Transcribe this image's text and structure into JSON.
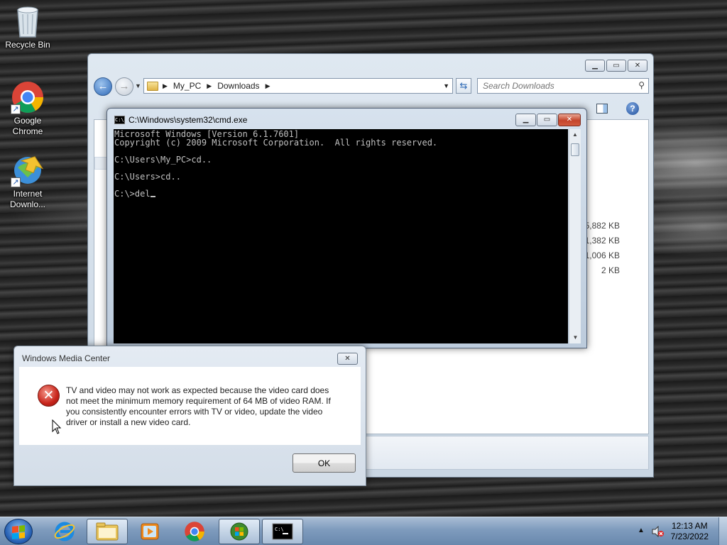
{
  "desktop": {
    "icons": [
      {
        "label": "Recycle Bin"
      },
      {
        "label": "Google Chrome"
      },
      {
        "label": "Internet Downlo..."
      }
    ]
  },
  "explorer": {
    "breadcrumb": [
      "My_PC",
      "Downloads"
    ],
    "search_placeholder": "Search Downloads",
    "file_sizes": [
      "75,882 KB",
      "1,382 KB",
      "11,006 KB",
      "2 KB"
    ]
  },
  "cmd": {
    "title": "C:\\Windows\\system32\\cmd.exe",
    "lines": [
      "Microsoft Windows [Version 6.1.7601]",
      "Copyright (c) 2009 Microsoft Corporation.  All rights reserved.",
      "",
      "C:\\Users\\My_PC>cd..",
      "",
      "C:\\Users>cd..",
      "",
      "C:\\>del"
    ]
  },
  "dialog": {
    "title": "Windows Media Center",
    "message": "TV and video may not work as expected because the video card does not meet the minimum memory requirement of 64 MB of video RAM. If you consistently encounter errors with TV or video, update the video driver or install a new video card.",
    "ok_label": "OK"
  },
  "taskbar": {
    "time": "12:13 AM",
    "date": "7/23/2022"
  },
  "colors": {
    "console_bg": "#000000",
    "console_fg": "#c0c0c0",
    "error_red": "#c8241b",
    "taskbar": "#7e9bbd"
  }
}
